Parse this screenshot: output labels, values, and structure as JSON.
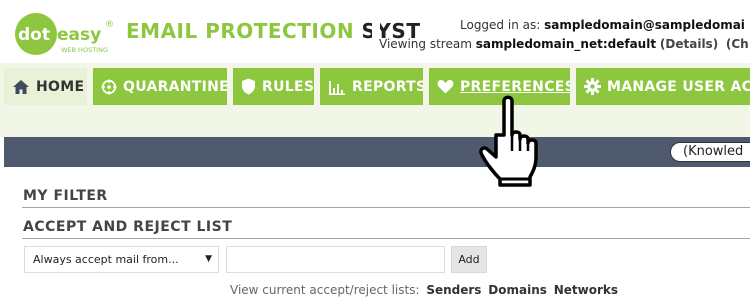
{
  "brand": {
    "logo_text_left": "dot",
    "logo_text_right": "easy",
    "logo_registered": "®",
    "logo_sub": "WEB HOSTING",
    "title_green": "EMAIL PROTECTION ",
    "title_dark": "SYST",
    "color_green": "#8dc63f",
    "color_dark": "#333333"
  },
  "user": {
    "logged_in_label": "Logged in as:",
    "logged_in_value": "sampledomain@sampledomai",
    "stream_label": "Viewing stream",
    "stream_value": "sampledomain_net:default",
    "details_link": "(Details)",
    "change_link": "(Ch"
  },
  "nav": {
    "tabs": [
      {
        "label": "HOME",
        "icon": "home-icon",
        "active": true
      },
      {
        "label": "QUARANTINE",
        "icon": "crosshair-icon"
      },
      {
        "label": "RULES",
        "icon": "shield-icon"
      },
      {
        "label": "REPORTS",
        "icon": "bar-chart-icon"
      },
      {
        "label": "PREFERENCES",
        "icon": "heart-icon",
        "hovered": true
      },
      {
        "label": "MANAGE USER ACC",
        "icon": "gear-icon"
      }
    ]
  },
  "toolbar": {
    "knowledge_button": "(Knowled"
  },
  "content": {
    "my_filter_heading": "MY FILTER",
    "list_heading": "ACCEPT AND REJECT LIST",
    "select_value": "Always accept mail from...",
    "address_placeholder": "",
    "add_button": "Add",
    "view_label": "View current accept/reject lists:",
    "view_links": [
      "Senders",
      "Domains",
      "Networks"
    ]
  },
  "cursor": {
    "icon": "hand-pointer-icon"
  }
}
